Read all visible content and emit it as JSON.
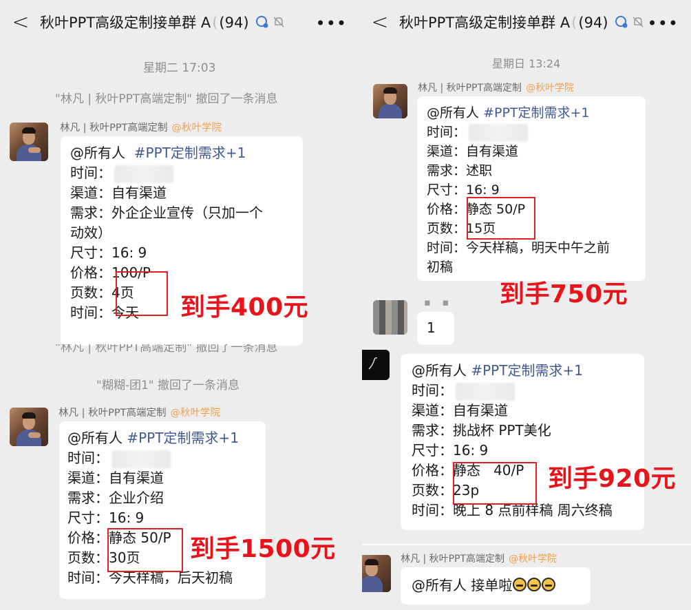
{
  "left": {
    "header": {
      "title": "秋叶PPT高级定制接单群 A",
      "count": "(94)"
    },
    "timestamp": "星期二 17:03",
    "recall_1": "\"林凡 | 秋叶PPT高端定制\" 撤回了一条消息",
    "recall_partial": "\"林凡 | 秋叶PPT高端定制\" 撤回了一条消息",
    "recall_2": "\"糊糊-团1\" 撤回了一条消息",
    "msg1": {
      "sender": "林凡 | 秋叶PPT高端定制",
      "sender_tag": "@秋叶学院",
      "mention": "@所有人",
      "topic": "#PPT定制需求+1",
      "time_label": "时间：",
      "channel": "渠道：自有渠道",
      "need_1": "需求：外企企业宣传（只加一个",
      "need_2": "动效）",
      "size": "尺寸：16: 9",
      "price_label": "价格：",
      "price": "100/P",
      "pages_label": "页数：",
      "pages": "4页",
      "time2": "时间：今天",
      "annotation": "到手400元"
    },
    "msg2": {
      "sender": "林凡 | 秋叶PPT高端定制",
      "sender_tag": "@秋叶学院",
      "mention": "@所有人",
      "topic": "#PPT定制需求+1",
      "time_label": "时间：",
      "channel": "渠道：自有渠道",
      "need": "需求：企业介绍",
      "size": "尺寸：16: 9",
      "price_label": "价格：",
      "price": "静态 50/P",
      "pages_label": "页数：",
      "pages": "30页",
      "time2": "时间：今天样稿，后天初稿",
      "annotation": "到手1500元"
    }
  },
  "right": {
    "header": {
      "title": "秋叶PPT高级定制接单群 A",
      "count": "(94)"
    },
    "timestamp": "星期日 13:24",
    "msg1": {
      "sender": "林凡 | 秋叶PPT高端定制",
      "sender_tag": "@秋叶学院",
      "mention": "@所有人",
      "topic": "#PPT定制需求+1",
      "time_label": "时间：",
      "channel": "渠道：自有渠道",
      "need": "需求：述职",
      "size": "尺寸：16: 9",
      "price_label": "价格：",
      "price": "静态 50/P",
      "pages_label": "页数：",
      "pages": "15页",
      "time2_1": "时间：今天样稿，明天中午之前",
      "time2_2": "初稿",
      "annotation": "到手750元"
    },
    "msg2": {
      "text": "1"
    },
    "msg3": {
      "mention": "@所有人",
      "topic": "#PPT定制需求+1",
      "time_label": "时间：",
      "channel": "渠道：自有渠道",
      "need": "需求：挑战杯 PPT美化",
      "size": "尺寸：16: 9",
      "price_label": "价格：",
      "price": "静态   40/P",
      "pages_label": "页数：",
      "pages": "23p",
      "time2": "时间：晚上 8 点前样稿 周六终稿",
      "annotation": "到手920元"
    },
    "msg4": {
      "sender": "林凡 | 秋叶PPT高端定制",
      "sender_tag": "@秋叶学院",
      "text": "@所有人 接单啦"
    }
  },
  "icons": {
    "back": "chevron-left-icon",
    "group": "group-chat-icon",
    "mute": "bell-off-icon",
    "more": "more-icon",
    "emoji": "emoji-icon"
  }
}
